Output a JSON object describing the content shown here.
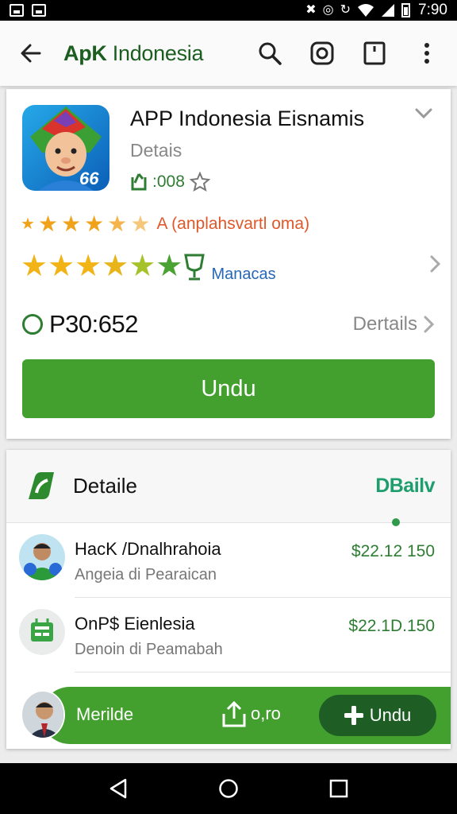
{
  "status_bar": {
    "time": "7:90",
    "icons": [
      "image-icon",
      "gallery-icon",
      "mute-icon",
      "alarm-icon",
      "sync-icon",
      "wifi-icon",
      "signal-icon",
      "battery-icon"
    ]
  },
  "app_bar": {
    "title_bold": "ApK",
    "title_rest": " Indonesia",
    "actions": [
      "search-icon",
      "instagram-icon",
      "bookmark-icon",
      "more-vert-icon"
    ]
  },
  "app_card": {
    "name": "APP Indonesia Eisnamis",
    "subtitle": "Detais",
    "meta": ":008",
    "rating_text": "A (anplahsvartl oma)",
    "reviews_label": "Manacas",
    "price": "P30:652",
    "details_link": "Dertails",
    "download_label": "Undu",
    "icon_badge": "66"
  },
  "list_card": {
    "header_title": "Detaile",
    "header_link": "DBailv",
    "items": [
      {
        "title": "HacK /Dnalhrahoia",
        "subtitle": "Angeia di Pearaican",
        "price": "$22.12 150"
      },
      {
        "title": "OnP$ Eienlesia",
        "subtitle": "Denoin di Peamabah",
        "price": "$22.1D.150"
      }
    ],
    "bottom": {
      "label": "Merilde",
      "share_label": "o,ro",
      "button_label": "Undu"
    }
  },
  "colors": {
    "accent_green": "#43a02f",
    "dark_green": "#1e5e25",
    "title_green": "#1b5e20",
    "rating_orange": "#e0582a",
    "link_blue": "#2767b8"
  }
}
